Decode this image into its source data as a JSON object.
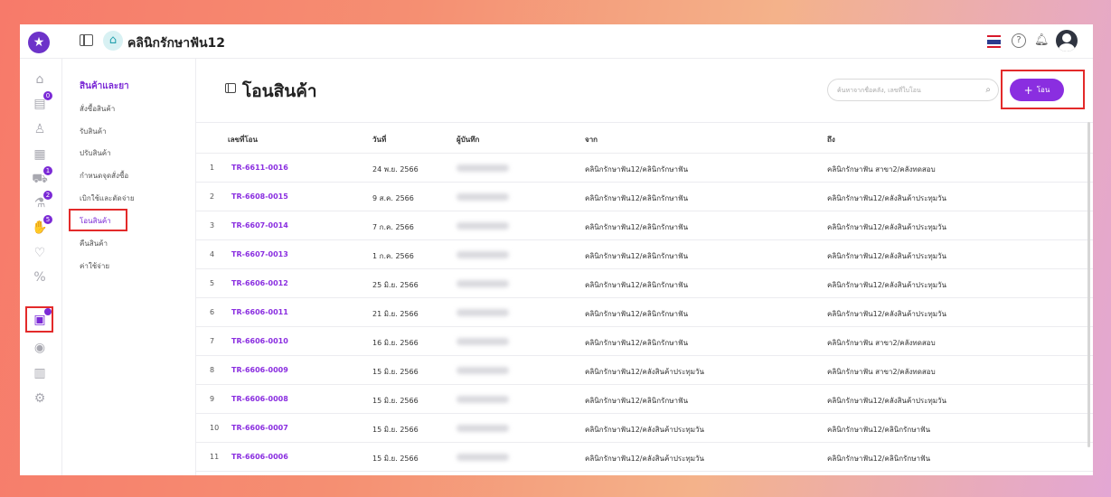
{
  "header": {
    "clinic_name": "คลินิกรักษาฟัน12",
    "icons": [
      "app-logo-star-icon",
      "sidebar-toggle-icon",
      "clinic-home-icon",
      "thai-flag-icon",
      "help-icon",
      "bell-icon",
      "avatar"
    ]
  },
  "rail": {
    "icons": [
      "home-icon",
      "appointment-icon",
      "patient-icon",
      "document-icon",
      "treatment-icon",
      "lab-icon",
      "payment-icon",
      "tooth-icon",
      "percent-icon",
      "inventory-box-icon",
      "finance-icon",
      "chart-icon",
      "settings-icon"
    ],
    "badges": [
      "0",
      "1",
      "2",
      "5"
    ]
  },
  "submenu": {
    "title": "สินค้าและยา",
    "items": [
      {
        "label": "สั่งซื้อสินค้า"
      },
      {
        "label": "รับสินค้า"
      },
      {
        "label": "ปรับสินค้า"
      },
      {
        "label": "กำหนดจุดสั่งซื้อ"
      },
      {
        "label": "เบิกใช้และตัดจ่าย"
      },
      {
        "label": "โอนสินค้า"
      },
      {
        "label": "คืนสินค้า"
      },
      {
        "label": "ค่าใช้จ่าย"
      }
    ]
  },
  "main": {
    "title": "โอนสินค้า",
    "search_placeholder": "ค้นหาจากชื่อคลัง, เลขที่ใบโอน",
    "add_label": "โอน"
  },
  "table": {
    "headers": {
      "ref": "เลขที่โอน",
      "date": "วันที่",
      "recorder": "ผู้บันทึก",
      "from": "จาก",
      "to": "ถึง"
    },
    "rows": [
      {
        "num": "1",
        "ref": "TR-6611-0016",
        "date": "24 พ.ย. 2566",
        "from": "คลินิกรักษาฟัน12/คลินิกรักษาฟัน",
        "to": "คลินิกรักษาฟัน สาขา2/คลังทดสอบ"
      },
      {
        "num": "2",
        "ref": "TR-6608-0015",
        "date": "9 ส.ค. 2566",
        "from": "คลินิกรักษาฟัน12/คลินิกรักษาฟัน",
        "to": "คลินิกรักษาฟัน12/คลังสินค้าประทุมวัน"
      },
      {
        "num": "3",
        "ref": "TR-6607-0014",
        "date": "7 ก.ค. 2566",
        "from": "คลินิกรักษาฟัน12/คลินิกรักษาฟัน",
        "to": "คลินิกรักษาฟัน12/คลังสินค้าประทุมวัน"
      },
      {
        "num": "4",
        "ref": "TR-6607-0013",
        "date": "1 ก.ค. 2566",
        "from": "คลินิกรักษาฟัน12/คลินิกรักษาฟัน",
        "to": "คลินิกรักษาฟัน12/คลังสินค้าประทุมวัน"
      },
      {
        "num": "5",
        "ref": "TR-6606-0012",
        "date": "25 มิ.ย. 2566",
        "from": "คลินิกรักษาฟัน12/คลินิกรักษาฟัน",
        "to": "คลินิกรักษาฟัน12/คลังสินค้าประทุมวัน"
      },
      {
        "num": "6",
        "ref": "TR-6606-0011",
        "date": "21 มิ.ย. 2566",
        "from": "คลินิกรักษาฟัน12/คลินิกรักษาฟัน",
        "to": "คลินิกรักษาฟัน12/คลังสินค้าประทุมวัน"
      },
      {
        "num": "7",
        "ref": "TR-6606-0010",
        "date": "16 มิ.ย. 2566",
        "from": "คลินิกรักษาฟัน12/คลินิกรักษาฟัน",
        "to": "คลินิกรักษาฟัน สาขา2/คลังทดสอบ"
      },
      {
        "num": "8",
        "ref": "TR-6606-0009",
        "date": "15 มิ.ย. 2566",
        "from": "คลินิกรักษาฟัน12/คลังสินค้าประทุมวัน",
        "to": "คลินิกรักษาฟัน สาขา2/คลังทดสอบ"
      },
      {
        "num": "9",
        "ref": "TR-6606-0008",
        "date": "15 มิ.ย. 2566",
        "from": "คลินิกรักษาฟัน12/คลินิกรักษาฟัน",
        "to": "คลินิกรักษาฟัน12/คลังสินค้าประทุมวัน"
      },
      {
        "num": "10",
        "ref": "TR-6606-0007",
        "date": "15 มิ.ย. 2566",
        "from": "คลินิกรักษาฟัน12/คลังสินค้าประทุมวัน",
        "to": "คลินิกรักษาฟัน12/คลินิกรักษาฟัน"
      },
      {
        "num": "11",
        "ref": "TR-6606-0006",
        "date": "15 มิ.ย. 2566",
        "from": "คลินิกรักษาฟัน12/คลังสินค้าประทุมวัน",
        "to": "คลินิกรักษาฟัน12/คลินิกรักษาฟัน"
      }
    ]
  },
  "colors": {
    "accent": "#8a2ee0",
    "highlight": "#e32a2a"
  }
}
